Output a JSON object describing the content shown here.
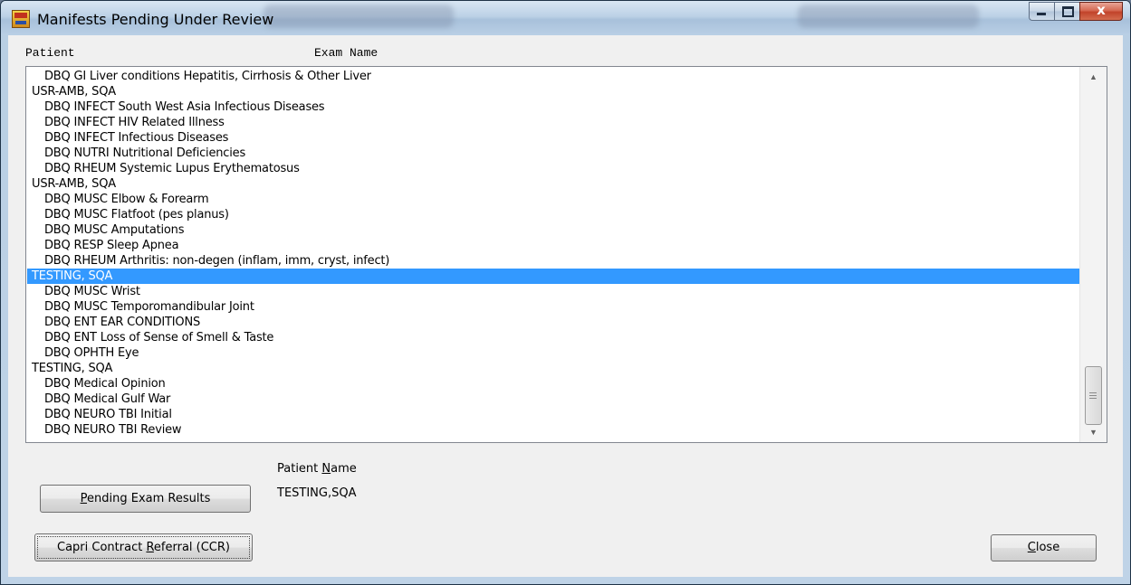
{
  "window": {
    "title": "Manifests Pending Under Review",
    "buttons": {
      "minimize": "minimize",
      "maximize": "maximize",
      "close": "x"
    }
  },
  "columns": {
    "patient": "Patient",
    "exam_name": "Exam Name"
  },
  "list": {
    "rows": [
      {
        "type": "exam",
        "text": "DBQ GI Liver conditions Hepatitis, Cirrhosis & Other Liver"
      },
      {
        "type": "patient",
        "text": "USR-AMB, SQA"
      },
      {
        "type": "exam",
        "text": "DBQ INFECT South West Asia Infectious Diseases"
      },
      {
        "type": "exam",
        "text": "DBQ INFECT HIV Related Illness"
      },
      {
        "type": "exam",
        "text": "DBQ INFECT Infectious Diseases"
      },
      {
        "type": "exam",
        "text": "DBQ NUTRI Nutritional Deficiencies"
      },
      {
        "type": "exam",
        "text": "DBQ RHEUM Systemic Lupus Erythematosus"
      },
      {
        "type": "patient",
        "text": "USR-AMB, SQA"
      },
      {
        "type": "exam",
        "text": "DBQ MUSC Elbow & Forearm"
      },
      {
        "type": "exam",
        "text": "DBQ MUSC Flatfoot (pes planus)"
      },
      {
        "type": "exam",
        "text": "DBQ MUSC Amputations"
      },
      {
        "type": "exam",
        "text": "DBQ RESP Sleep Apnea"
      },
      {
        "type": "exam",
        "text": "DBQ RHEUM Arthritis: non-degen (inflam, imm, cryst, infect)"
      },
      {
        "type": "patient",
        "text": "TESTING, SQA",
        "selected": true
      },
      {
        "type": "exam",
        "text": "DBQ MUSC Wrist"
      },
      {
        "type": "exam",
        "text": "DBQ MUSC Temporomandibular Joint"
      },
      {
        "type": "exam",
        "text": "DBQ ENT EAR CONDITIONS"
      },
      {
        "type": "exam",
        "text": "DBQ ENT Loss of Sense of Smell & Taste"
      },
      {
        "type": "exam",
        "text": "DBQ OPHTH Eye"
      },
      {
        "type": "patient",
        "text": "TESTING, SQA"
      },
      {
        "type": "exam",
        "text": "DBQ Medical Opinion"
      },
      {
        "type": "exam",
        "text": "DBQ Medical Gulf War"
      },
      {
        "type": "exam",
        "text": "DBQ NEURO TBI Initial"
      },
      {
        "type": "exam",
        "text": "DBQ NEURO TBI Review"
      }
    ],
    "scroll_position": 0.92
  },
  "patient_name": {
    "label_pre": "Patient ",
    "label_accel": "N",
    "label_post": "ame",
    "value": "TESTING,SQA"
  },
  "buttons": {
    "pending": {
      "pre": "",
      "accel": "P",
      "post": "ending Exam Results"
    },
    "capri": {
      "pre": "Capri Contract ",
      "accel": "R",
      "post": "eferral (CCR)"
    },
    "close": {
      "pre": "",
      "accel": "C",
      "post": "lose"
    }
  },
  "colors": {
    "selection": "#3399ff",
    "close_button": "#c1432a"
  }
}
